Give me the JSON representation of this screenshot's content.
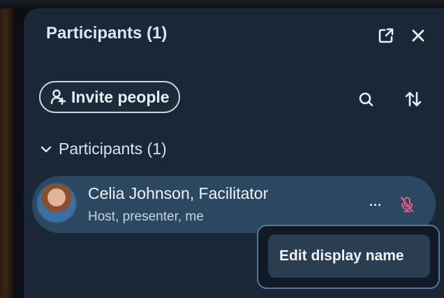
{
  "header": {
    "title": "Participants (1)",
    "icons": [
      "popout-icon",
      "close-icon"
    ]
  },
  "toolbar": {
    "invite_label": "Invite people",
    "icons": [
      "search-icon",
      "sort-icon"
    ]
  },
  "section": {
    "label": "Participants (1)",
    "expanded": true
  },
  "participant": {
    "name": "Celia Johnson, Facilitator",
    "role": "Host, presenter, me",
    "more_label": "...",
    "muted": true,
    "mute_color": "#e85a8a"
  },
  "context_menu": {
    "items": [
      {
        "label": "Edit display name"
      }
    ]
  }
}
